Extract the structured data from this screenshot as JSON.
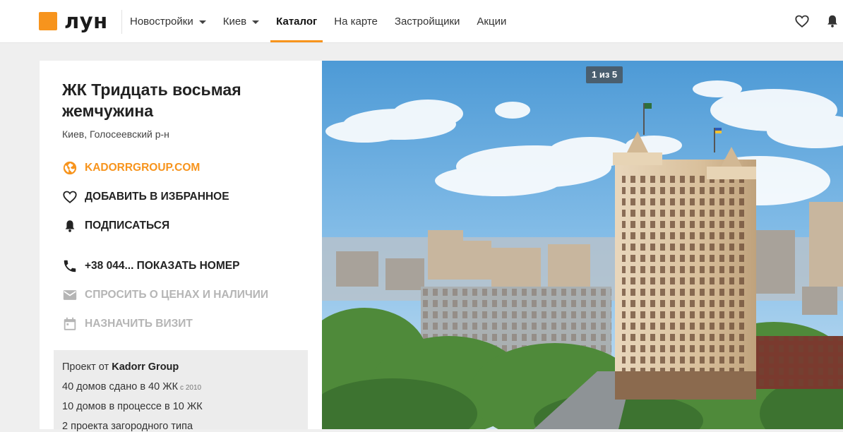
{
  "header": {
    "logo_text": "лун",
    "nav": [
      {
        "label": "Новостройки",
        "dropdown": true
      },
      {
        "label": "Киев",
        "dropdown": true
      },
      {
        "label": "Каталог",
        "active": true
      },
      {
        "label": "На карте"
      },
      {
        "label": "Застройщики"
      },
      {
        "label": "Акции"
      }
    ],
    "icons": [
      "heart-icon",
      "bell-icon"
    ]
  },
  "project": {
    "title": "ЖК Тридцать восьмая жемчужина",
    "location": "Киев, Голосеевский р-н",
    "actions": {
      "website": "KADORRGROUP.COM",
      "favorite": "ДОБАВИТЬ В ИЗБРАННОЕ",
      "subscribe": "ПОДПИСАТЬСЯ",
      "phone": "+38 044... ПОКАЗАТЬ НОМЕР",
      "ask_prices": "СПРОСИТЬ О ЦЕНАХ И НАЛИЧИИ",
      "schedule_visit": "НАЗНАЧИТЬ ВИЗИТ"
    },
    "developer": {
      "prefix": "Проект от",
      "name": "Kadorr Group",
      "line1": "40 домов сдано в 40 ЖК",
      "line1_note": "с 2010",
      "line2": "10 домов в процессе в 10 ЖК",
      "line3": "2 проекта загородного типа"
    }
  },
  "gallery": {
    "counter": "1 из 5"
  },
  "colors": {
    "accent": "#f7941d",
    "disabled": "#b5b5b5",
    "info_bg": "#ececec"
  }
}
